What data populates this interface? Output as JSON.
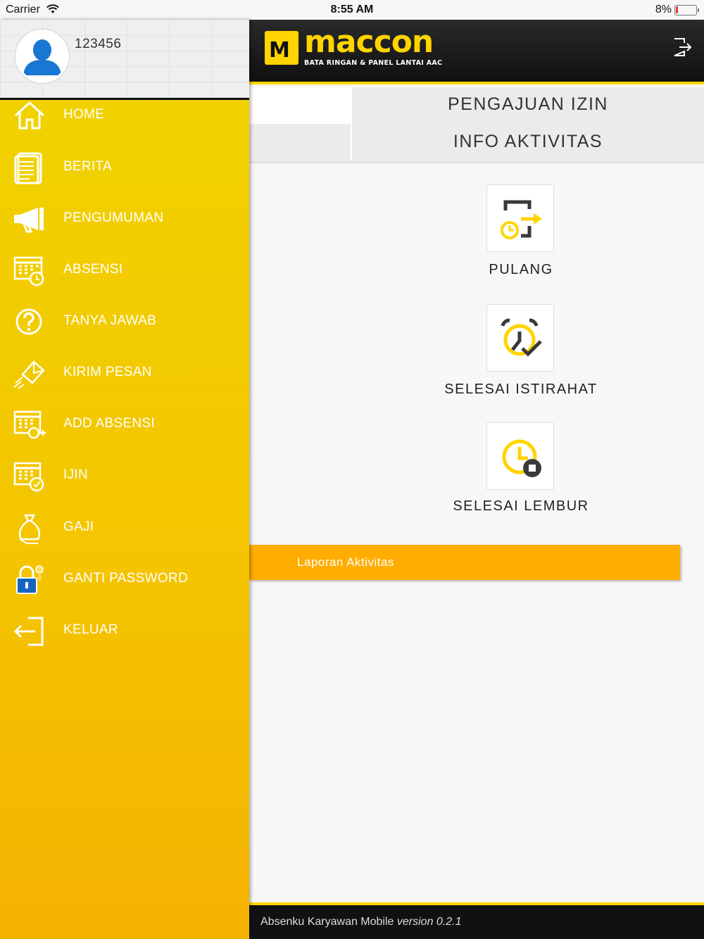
{
  "status_bar": {
    "carrier": "Carrier",
    "time": "8:55 AM",
    "battery": "8%"
  },
  "header": {
    "logo_word": "maccon",
    "logo_tagline": "BATA RINGAN & PANEL LANTAI AAC"
  },
  "profile": {
    "user_id": "123456"
  },
  "menu": {
    "items": [
      {
        "label": "HOME",
        "icon": "home-icon"
      },
      {
        "label": "BERITA",
        "icon": "newspaper-icon"
      },
      {
        "label": "PENGUMUMAN",
        "icon": "megaphone-icon"
      },
      {
        "label": "ABSENSI",
        "icon": "calendar-clock-icon"
      },
      {
        "label": "TANYA JAWAB",
        "icon": "question-icon"
      },
      {
        "label": "KIRIM PESAN",
        "icon": "send-message-icon"
      },
      {
        "label": "ADD ABSENSI",
        "icon": "calendar-add-icon"
      },
      {
        "label": "IJIN",
        "icon": "calendar-check-icon"
      },
      {
        "label": "GAJI",
        "icon": "money-bag-icon"
      },
      {
        "label": "GANTI PASSWORD",
        "icon": "lock-key-icon"
      },
      {
        "label": "KELUAR",
        "icon": "exit-icon"
      }
    ]
  },
  "tabs": {
    "tab1": "PENGAJUAN IZIN",
    "tab2": "INFO AKTIVITAS"
  },
  "actions": {
    "pulang": "PULANG",
    "selesai_istirahat": "SELESAI ISTIRAHAT",
    "selesai_lembur": "SELESAI LEMBUR"
  },
  "laporan": {
    "label": "Laporan Aktivitas"
  },
  "footer": {
    "app_name": "Absenku Karyawan Mobile",
    "version": "version 0.2.1"
  },
  "colors": {
    "accent_yellow": "#ffd400",
    "laporan_orange": "#ffad00",
    "dark": "#111111"
  }
}
